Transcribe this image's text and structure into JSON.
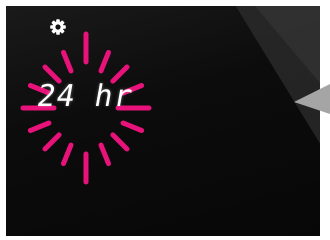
{
  "display": {
    "mode_label": "24 hr",
    "indicator_color": "#e8127a",
    "text_color": "#ffffff",
    "background_color": "#0c0c0c"
  },
  "icons": {
    "settings": "gear-icon",
    "selection_ring": "sunburst-highlight-icon",
    "pointer": "pointer-arrow-icon"
  }
}
